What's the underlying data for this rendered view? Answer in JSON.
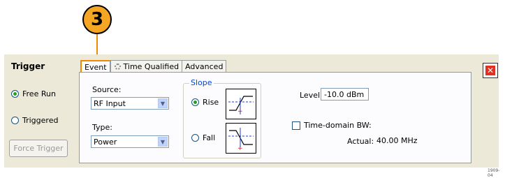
{
  "callout": {
    "number": "3"
  },
  "trigger": {
    "title": "Trigger",
    "modes": [
      {
        "label": "Free Run",
        "selected": true
      },
      {
        "label": "Triggered",
        "selected": false
      }
    ],
    "force_trigger_label": "Force Trigger"
  },
  "tabs": [
    {
      "label": "Event",
      "active": true
    },
    {
      "label": "Time Qualified",
      "active": false
    },
    {
      "label": "Advanced",
      "active": false
    }
  ],
  "event": {
    "source_label": "Source:",
    "source_value": "RF Input",
    "type_label": "Type:",
    "type_value": "Power",
    "slope": {
      "title": "Slope",
      "options": [
        {
          "label": "Rise",
          "selected": true
        },
        {
          "label": "Fall",
          "selected": false
        }
      ]
    },
    "level_label": "Level:",
    "level_value": "-10.0 dBm",
    "time_domain_bw_label": "Time-domain BW:",
    "time_domain_bw_checked": false,
    "actual_label": "Actual:",
    "actual_value": "40.00 MHz"
  },
  "footnote": "1909-04",
  "colors": {
    "callout": "#f5a623",
    "accent": "#f08a00",
    "close": "#e32e20"
  }
}
